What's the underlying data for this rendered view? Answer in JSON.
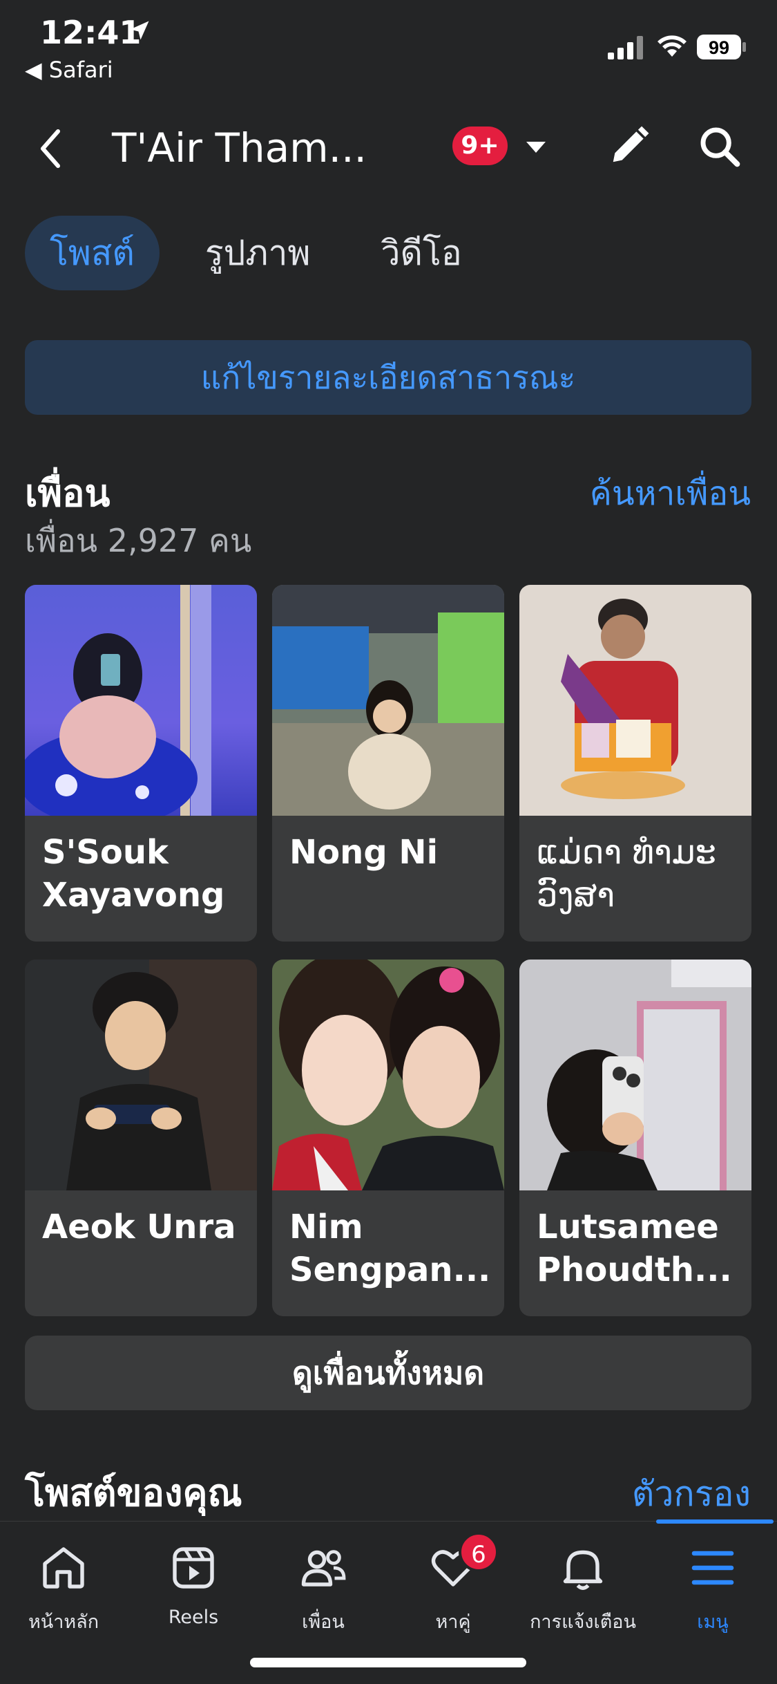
{
  "status_bar": {
    "time": "12:41",
    "back_app": "◀ Safari",
    "battery": "99"
  },
  "header": {
    "title": "T'Air Tham...",
    "notification_badge": "9+"
  },
  "tabs": [
    {
      "label": "โพสต์",
      "active": true
    },
    {
      "label": "รูปภาพ",
      "active": false
    },
    {
      "label": "วิดีโอ",
      "active": false
    }
  ],
  "edit_details_label": "แก้ไขรายละเอียดสาธารณะ",
  "friends": {
    "title": "เพื่อน",
    "count_text": "เพื่อน 2,927 คน",
    "find_label": "ค้นหาเพื่อน",
    "items": [
      {
        "name": "S'Souk Xayavong"
      },
      {
        "name": "Nong Ni"
      },
      {
        "name": "ແມ່ດາ ທຳມະ ວົງສາ"
      },
      {
        "name": "Aeok Unra"
      },
      {
        "name": "Nim Sengpan..."
      },
      {
        "name": "Lutsamee Phoudth..."
      }
    ],
    "see_all_label": "ดูเพื่อนทั้งหมด"
  },
  "posts": {
    "title": "โพสต์ของคุณ",
    "filter_label": "ตัวกรอง"
  },
  "bottom_nav": [
    {
      "label": "หน้าหลัก",
      "icon": "home-icon"
    },
    {
      "label": "Reels",
      "icon": "reels-icon"
    },
    {
      "label": "เพื่อน",
      "icon": "friends-icon"
    },
    {
      "label": "หาคู่",
      "icon": "dating-icon",
      "badge": "6"
    },
    {
      "label": "การแจ้งเตือน",
      "icon": "bell-icon"
    },
    {
      "label": "เมนู",
      "icon": "menu-icon",
      "active": true
    }
  ],
  "colors": {
    "background": "#242526",
    "card": "#3a3b3c",
    "accent": "#4599ff",
    "badge": "#e41e3f"
  }
}
